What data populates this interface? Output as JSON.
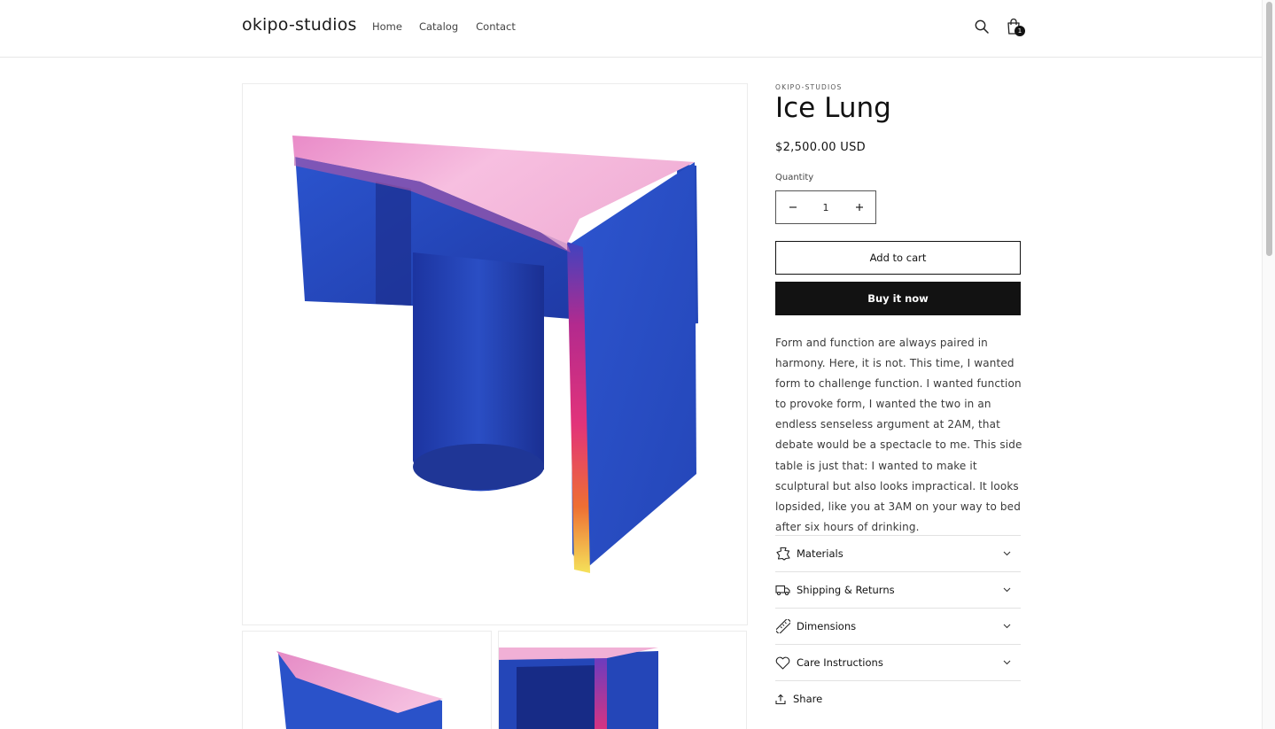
{
  "header": {
    "logo": "okipo-studios",
    "nav": [
      "Home",
      "Catalog",
      "Contact"
    ],
    "cart_count": "1",
    "icons": {
      "search": "search-icon",
      "cart": "cart-icon"
    }
  },
  "product": {
    "vendor": "OKIPO-STUDIOS",
    "title": "Ice Lung",
    "price": "$2,500.00 USD",
    "quantity_label": "Quantity",
    "quantity_value": "1",
    "add_to_cart": "Add to cart",
    "buy_now": "Buy it now",
    "description": "Form and function are always paired in harmony. Here, it is not. This time, I wanted form to challenge function. I wanted function to provoke form, I wanted the two in an endless senseless argument at 2AM, that debate would be a spectacle to me. This side table is just that: I wanted to make it sculptural but also looks impractical. It looks lopsided, like you at 3AM on your way to bed after six hours of drinking.",
    "accordions": [
      {
        "label": "Materials",
        "icon": "materials-icon"
      },
      {
        "label": "Shipping & Returns",
        "icon": "truck-icon"
      },
      {
        "label": "Dimensions",
        "icon": "ruler-icon"
      },
      {
        "label": "Care Instructions",
        "icon": "heart-icon"
      }
    ],
    "share": "Share"
  },
  "colors": {
    "table_blue": "#2a52c9",
    "table_top_pink": "#f4b6d8",
    "edge_magenta": "#e0337a",
    "edge_orange": "#f28a2e",
    "edge_yellow": "#f5e05a",
    "button_dark": "#121212"
  }
}
